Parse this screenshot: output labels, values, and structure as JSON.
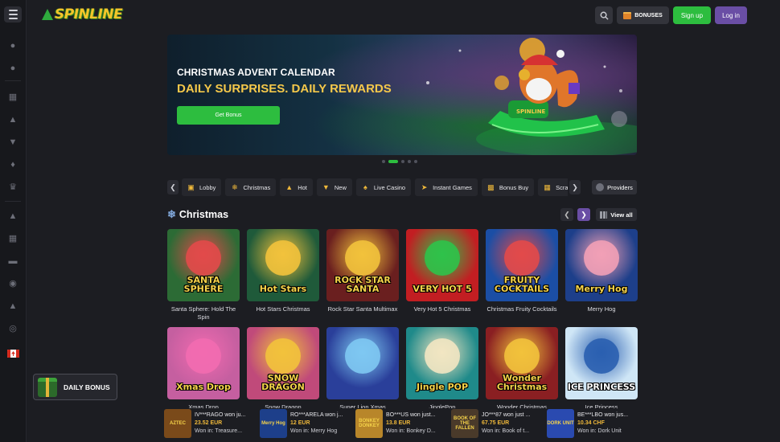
{
  "header": {
    "logo_text": "SPINLINE",
    "bonuses_label": "BONUSES",
    "signup_label": "Sign up",
    "login_label": "Log in"
  },
  "sidebar": {
    "icons": [
      "user-icon",
      "user-add-icon",
      "slots-icon",
      "casino-icon",
      "basket-icon",
      "crown-badge-icon",
      "crown-icon",
      "christmas-tree-icon",
      "calendar-icon",
      "ticket-icon",
      "live-icon",
      "trophy-icon",
      "target-icon",
      "canada-flag-icon"
    ]
  },
  "banner": {
    "title": "CHRISTMAS ADVENT CALENDAR",
    "subtitle": "DAILY SURPRISES. DAILY REWARDS",
    "cta_label": "Get Bonus",
    "art_logo": "SPINLINE",
    "slides": 5,
    "active_slide": 2
  },
  "categories": {
    "tabs": [
      {
        "label": "Lobby",
        "icon": "lobby-icon"
      },
      {
        "label": "Christmas",
        "icon": "snowflake-icon"
      },
      {
        "label": "Hot",
        "icon": "fire-icon"
      },
      {
        "label": "New",
        "icon": "new-badge-icon"
      },
      {
        "label": "Live Casino",
        "icon": "live-casino-icon"
      },
      {
        "label": "Instant Games",
        "icon": "lightning-icon"
      },
      {
        "label": "Bonus Buy",
        "icon": "bonus-buy-icon"
      },
      {
        "label": "Scratch",
        "icon": "scratch-icon"
      }
    ],
    "providers_label": "Providers"
  },
  "section": {
    "title": "Christmas",
    "view_all_label": "View all"
  },
  "games_row1": [
    {
      "name": "Santa Sphere: Hold The Spin",
      "logo": "SANTA SPHERE",
      "bg": "#2c6b35",
      "accent": "#e24a4a"
    },
    {
      "name": "Hot Stars Christmas",
      "logo": "Hot Stars",
      "bg": "#1f5a3a",
      "accent": "#f2c23c"
    },
    {
      "name": "Rock Star Santa Multimax",
      "logo": "ROCK STAR SANTA",
      "bg": "#6a1f1f",
      "accent": "#f2c23c"
    },
    {
      "name": "Very Hot 5 Christmas",
      "logo": "VERY HOT 5",
      "bg": "#c21e22",
      "accent": "#2fc24a"
    },
    {
      "name": "Christmas Fruity Cocktails",
      "logo": "FRUITY COCKTAILS",
      "bg": "#1b4ea5",
      "accent": "#e24a4a"
    },
    {
      "name": "Merry Hog",
      "logo": "Merry Hog",
      "bg": "#1d3f8a",
      "accent": "#f2a0b6"
    }
  ],
  "games_row2": [
    {
      "name": "Xmas Drop",
      "logo": "Xmas Drop",
      "bg": "#c55fa0",
      "accent": "#f26bb0"
    },
    {
      "name": "Snow Dragon",
      "logo": "SNOW DRAGON",
      "bg": "#c04a7a",
      "accent": "#f2c23c"
    },
    {
      "name": "Super Lion Xmas",
      "logo": "",
      "bg": "#2a3f9a",
      "accent": "#7ec8f2"
    },
    {
      "name": "JinglePop",
      "logo": "Jingle POP",
      "bg": "#1f8a8a",
      "accent": "#f2e6c2"
    },
    {
      "name": "Wonder Christmas",
      "logo": "Wonder Christmas",
      "bg": "#8a1f22",
      "accent": "#f2c23c"
    },
    {
      "name": "Ice Princess",
      "logo": "ICE PRINCESS",
      "bg": "#cfe6f6",
      "accent": "#2a5fb0"
    }
  ],
  "daily_bonus": {
    "label": "DAILY BONUS"
  },
  "winners": [
    {
      "user": "IV***RAGO won ju...",
      "amount": "23.52 EUR",
      "game": "Won in: Treasure...",
      "thumb_label": "AZTEC",
      "thumb_bg": "#7a4a1a"
    },
    {
      "user": "RO***ARELA won j...",
      "amount": "12 EUR",
      "game": "Won in: Merry Hog",
      "thumb_label": "Merry Hog",
      "thumb_bg": "#1d3f8a"
    },
    {
      "user": "BO***US won just...",
      "amount": "13.8 EUR",
      "game": "Won in: Bonkey D...",
      "thumb_label": "BONKEY DONKEY",
      "thumb_bg": "#b8862a"
    },
    {
      "user": "JO***87 won just ...",
      "amount": "67.75 EUR",
      "game": "Won in: Book of t...",
      "thumb_label": "BOOK OF THE FALLEN",
      "thumb_bg": "#4a3a2a"
    },
    {
      "user": "BE***LBO won jus...",
      "amount": "10.34 CHF",
      "game": "Won in: Dork Unit",
      "thumb_label": "DORK UNIT",
      "thumb_bg": "#2a4ab0"
    }
  ]
}
